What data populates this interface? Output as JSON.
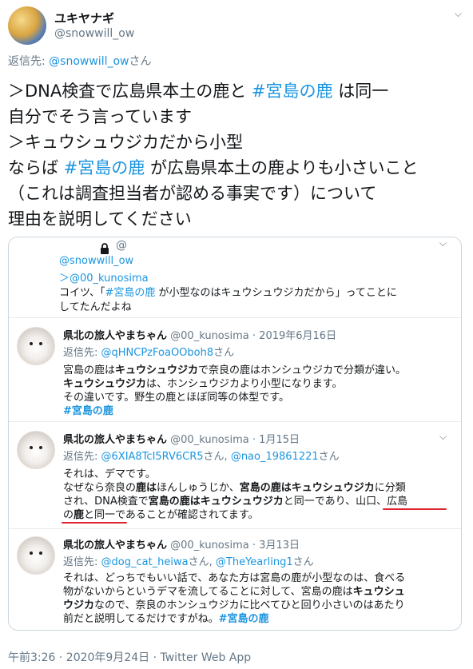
{
  "header": {
    "display_name": "ユキヤナギ",
    "handle": "@snowwill_ow",
    "menu_icon": "chevron-down-icon"
  },
  "reply_to": {
    "prefix": "返信先: ",
    "user": "@snowwill_ow",
    "suffix": "さん"
  },
  "body": {
    "line1_a": "＞DNA検査で広島県本土の鹿と ",
    "line1_tag": "#宮島の鹿",
    "line1_b": " は同一",
    "line2": "自分でそう言っています",
    "line3": "＞キュウシュウジカだから小型",
    "line4_a": "ならば ",
    "line4_tag": "#宮島の鹿",
    "line4_b": " が広島県本土の鹿よりも小さいこと",
    "line5": "（これは調査担当者が認める事実です）について",
    "line6": "理由を説明してください"
  },
  "quoted": {
    "at": "@",
    "lock_icon": "lock-icon",
    "line1": "@snowwill_ow",
    "line2": "＞@00_kunosima",
    "line3_a": "コイツ、「",
    "line3_tag": "#宮島の鹿",
    "line3_b": " が小型なのはキュウシュウジカだから」ってことに",
    "line4": "してたんだよね"
  },
  "replies": [
    {
      "name": "県北の旅人やまちゃん",
      "handle_date": "@00_kunosima · 2019年6月16日",
      "reply_prefix": "返信先: ",
      "reply_user": "@qHNCPzFoaOOboh8",
      "reply_suffix": "さん",
      "l1_a": "宮島の鹿は",
      "l1_b": "キュウシュウジカ",
      "l1_c": "で奈良の鹿はホンシュウジカで分類が違い。",
      "l2_a": "キュウシュウジカ",
      "l2_b": "は、ホンシュウジカより小型になります。",
      "l3": "その違いです。野生の鹿とほぼ同等の体型です。",
      "l4_tag": "#宮島の鹿"
    },
    {
      "name": "県北の旅人やまちゃん",
      "handle_date": "@00_kunosima · 1月15日",
      "reply_prefix": "返信先: ",
      "reply_user": "@6XIA8TcI5RV6CR5",
      "reply_mid": "さん, ",
      "reply_user2": "@nao_19861221",
      "reply_suffix": "さん",
      "l1": "それは、デマです。",
      "l2_a": "なぜなら奈良の",
      "l2_b": "鹿は",
      "l2_c": "ほんしゅうじか、",
      "l2_d": "宮島の鹿はキュウシュウジカ",
      "l2_e": "に分類",
      "l3_a": "され、DNA検査で",
      "l3_b": "宮島の鹿はキュウシュウジカ",
      "l3_c": "と同一であり、山口、広島",
      "l4_a": "の",
      "l4_b": "鹿",
      "l4_c": "と同一であることが確認されてます。"
    },
    {
      "name": "県北の旅人やまちゃん",
      "handle_date": "@00_kunosima · 3月13日",
      "reply_prefix": "返信先: ",
      "reply_user": "@dog_cat_heiwa",
      "reply_mid": "さん, ",
      "reply_user2": "@TheYearling1",
      "reply_suffix": "さん",
      "l1": "それは、どっちでもいい話で、あなた方は宮島の鹿が小型なのは、食べる",
      "l2_a": "物がないからというデマを流してることに対して、宮島の鹿は",
      "l2_b": "キュウシュ",
      "l3_a": "ウジカ",
      "l3_b": "なので、奈良のホンシュウジカに比べてひと回り小さいのはあたり",
      "l4_a": "前だと説明してるだけですがね。",
      "l4_tag": "#宮島の鹿"
    }
  ],
  "footer": "午前3:26 · 2020年9月24日 · Twitter Web App"
}
